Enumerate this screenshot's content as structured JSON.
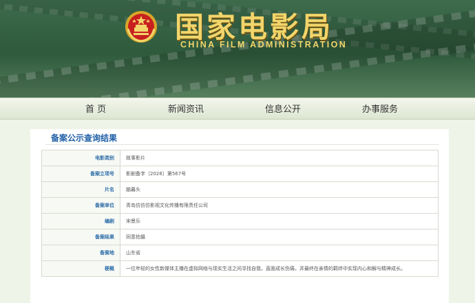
{
  "header": {
    "site_title": "国家电影局",
    "site_subtitle": "CHINA FILM ADMINISTRATION",
    "emblem_icon": "national-emblem-icon"
  },
  "nav": {
    "items": [
      {
        "label": "首 页"
      },
      {
        "label": "新闻资讯"
      },
      {
        "label": "信息公开"
      },
      {
        "label": "办事服务"
      }
    ]
  },
  "main": {
    "title": "备案公示查询结果",
    "records": [
      {
        "label": "电影类别",
        "value": "故事影片"
      },
      {
        "label": "备案立项号",
        "value": "影剧备字〔2026〕第567号"
      },
      {
        "label": "片名",
        "value": "脑暮头"
      },
      {
        "label": "备案单位",
        "value": "青岛仿仿仿影视文化传播有限责任公司"
      },
      {
        "label": "编剧",
        "value": "宋景乐"
      },
      {
        "label": "备案结果",
        "value": "同意拍摄"
      },
      {
        "label": "备案地",
        "value": "山东省"
      },
      {
        "label": "梗概",
        "value": "一位年轻的女性新媒体主播在虚拟网络与现实生活之间寻找自我，直面成长伤痛，并最终在亲情的羁绊中实现内心和解与精神成长。"
      }
    ]
  },
  "colors": {
    "banner_green": "#2f5a3c",
    "title_gold": "#f2d56b",
    "accent_blue": "#1f5fa6",
    "page_background": "#eef4e8"
  }
}
